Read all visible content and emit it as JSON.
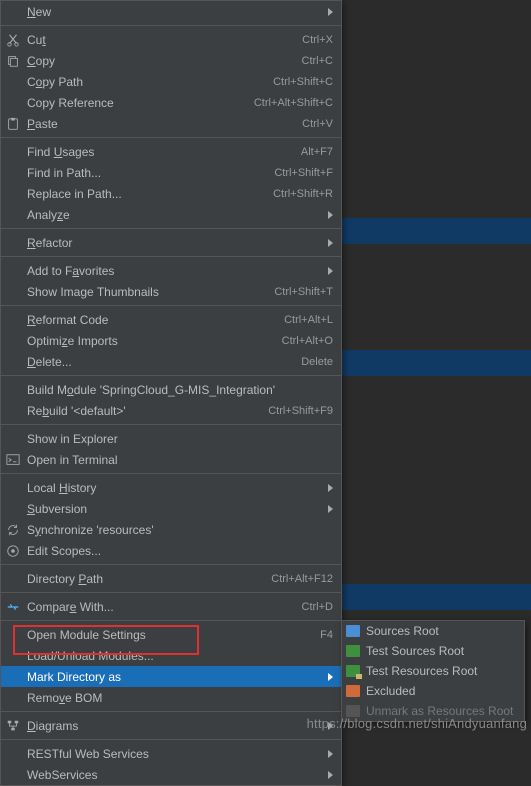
{
  "menu": {
    "new": "New",
    "cut": "Cut",
    "cut_sc": "Ctrl+X",
    "copy": "Copy",
    "copy_sc": "Ctrl+C",
    "copypath": "Copy Path",
    "copypath_sc": "Ctrl+Shift+C",
    "copyref": "Copy Reference",
    "copyref_sc": "Ctrl+Alt+Shift+C",
    "paste": "Paste",
    "paste_sc": "Ctrl+V",
    "findusages": "Find Usages",
    "findusages_sc": "Alt+F7",
    "findinpath": "Find in Path...",
    "findinpath_sc": "Ctrl+Shift+F",
    "replaceinpath": "Replace in Path...",
    "replaceinpath_sc": "Ctrl+Shift+R",
    "analyze": "Analyze",
    "refactor": "Refactor",
    "addfav": "Add to Favorites",
    "thumbs": "Show Image Thumbnails",
    "thumbs_sc": "Ctrl+Shift+T",
    "reformat": "Reformat Code",
    "reformat_sc": "Ctrl+Alt+L",
    "optimize": "Optimize Imports",
    "optimize_sc": "Ctrl+Alt+O",
    "delete": "Delete...",
    "delete_sc": "Delete",
    "buildmod": "Build Module 'SpringCloud_G-MIS_Integration'",
    "rebuild": "Rebuild '<default>'",
    "rebuild_sc": "Ctrl+Shift+F9",
    "explorer": "Show in Explorer",
    "terminal": "Open in Terminal",
    "localhist": "Local History",
    "subversion": "Subversion",
    "sync": "Synchronize 'resources'",
    "editscopes": "Edit Scopes...",
    "dirpath": "Directory Path",
    "dirpath_sc": "Ctrl+Alt+F12",
    "compare": "Compare With...",
    "compare_sc": "Ctrl+D",
    "openmodset": "Open Module Settings",
    "openmodset_sc": "F4",
    "loadunload": "Load/Unload Modules...",
    "markdir": "Mark Directory as",
    "removebom": "Remove BOM",
    "diagrams": "Diagrams",
    "restful": "RESTful Web Services",
    "webservices": "WebServices"
  },
  "submenu": {
    "sources": "Sources Root",
    "testsrc": "Test Sources Root",
    "testres": "Test Resources Root",
    "excluded": "Excluded",
    "unmark": "Unmark as Resources Root"
  },
  "watermark": "https://blog.csdn.net/shiAndyuanfang"
}
